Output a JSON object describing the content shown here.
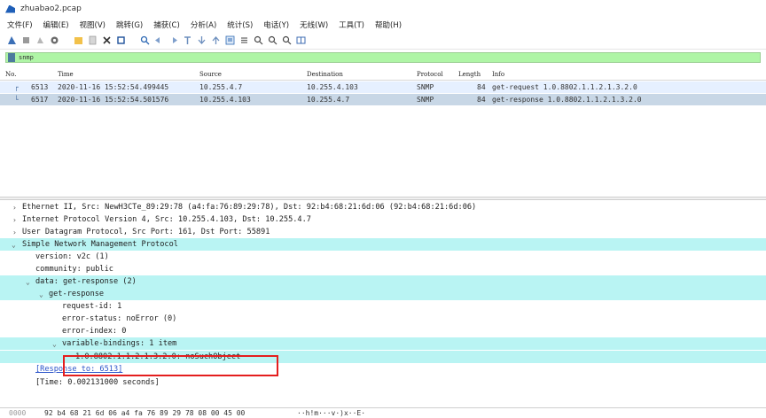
{
  "window": {
    "title": "zhuabao2.pcap"
  },
  "menu": [
    "文件(F)",
    "编辑(E)",
    "视图(V)",
    "跳转(G)",
    "捕获(C)",
    "分析(A)",
    "统计(S)",
    "电话(Y)",
    "无线(W)",
    "工具(T)",
    "帮助(H)"
  ],
  "toolbar_icons": [
    "shark-fin-icon",
    "stop-icon",
    "restart-icon",
    "options-icon",
    "open-file-icon",
    "save-icon",
    "close-file-icon",
    "reload-icon",
    "find-icon",
    "back-icon",
    "forward-icon",
    "go-to-packet-icon",
    "first-packet-icon",
    "last-packet-icon",
    "autoscroll-icon",
    "colorize-icon",
    "zoom-in-icon",
    "zoom-out-icon",
    "normal-size-icon",
    "resize-columns-icon"
  ],
  "filter": {
    "value": "snmp"
  },
  "packet_list": {
    "columns": {
      "no": "No.",
      "time": "Time",
      "source": "Source",
      "destination": "Destination",
      "protocol": "Protocol",
      "length": "Length",
      "info": "Info"
    },
    "rows": [
      {
        "no": "6513",
        "time": "2020-11-16 15:52:54.499445",
        "source": "10.255.4.7",
        "destination": "10.255.4.103",
        "protocol": "SNMP",
        "length": "84",
        "info": "get-request 1.0.8802.1.1.2.1.3.2.0"
      },
      {
        "no": "6517",
        "time": "2020-11-16 15:52:54.501576",
        "source": "10.255.4.103",
        "destination": "10.255.4.7",
        "protocol": "SNMP",
        "length": "84",
        "info": "get-response 1.0.8802.1.1.2.1.3.2.0"
      }
    ]
  },
  "details": {
    "ethernet": "Ethernet II, Src: NewH3CTe_89:29:78 (a4:fa:76:89:29:78), Dst: 92:b4:68:21:6d:06 (92:b4:68:21:6d:06)",
    "ip": "Internet Protocol Version 4, Src: 10.255.4.103, Dst: 10.255.4.7",
    "udp": "User Datagram Protocol, Src Port: 161, Dst Port: 55891",
    "snmp": "Simple Network Management Protocol",
    "version": "version: v2c (1)",
    "community": "community: public",
    "data": "data: get-response (2)",
    "get_response": "get-response",
    "request_id": "request-id: 1",
    "error_status": "error-status: noError (0)",
    "error_index": "error-index: 0",
    "varbinds": "variable-bindings: 1 item",
    "varbind": "1.0.8802.1.1.2.1.3.2.0: noSuchObject",
    "response_to": "[Response to: 6513]",
    "time": "[Time: 0.002131000 seconds]"
  },
  "bytes": {
    "offset": "0000",
    "hex": "92 b4 68 21 6d 06 a4 fa  76 89 29 78 08 00 45 00",
    "ascii": "··h!m···v·)x··E·"
  }
}
